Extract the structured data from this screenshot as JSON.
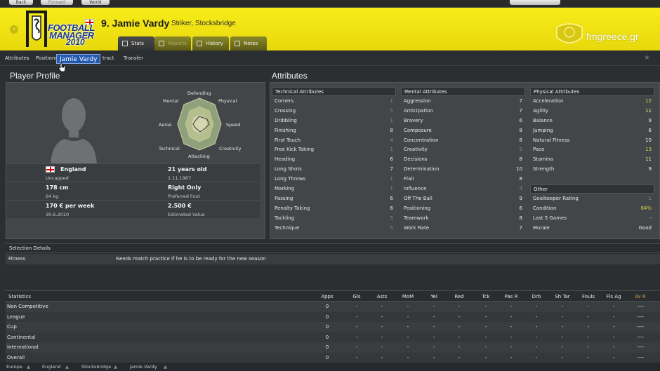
{
  "nav": {
    "back": "Back",
    "forward": "Forward",
    "world": "World"
  },
  "header": {
    "name": "9. Jamie Vardy",
    "subtitle": "Striker, Stocksbridge",
    "tabs": [
      {
        "label": "Stats"
      },
      {
        "label": "Reports"
      },
      {
        "label": "History"
      },
      {
        "label": "Notes"
      }
    ],
    "logo": {
      "line1": "FOOTBALL",
      "line2": "MANAGER",
      "line3": "2010"
    },
    "tooltip": "Jamie Vardy",
    "site": "fmgreece.gr",
    "accent": "#f3e515"
  },
  "subnav": [
    "Attributes",
    "Positions",
    "tract",
    "Transfer"
  ],
  "profile": {
    "title": "Player Profile",
    "radar_labels": [
      "Defending",
      "Physical",
      "Speed",
      "Creativity",
      "Attacking",
      "Technical",
      "Aerial",
      "Mental"
    ],
    "nationality": "England",
    "caps": "Uncapped",
    "age": "21 years old",
    "dob": "1.11.1987",
    "height": "178 cm",
    "weight": "64 kg",
    "foot": "Right Only",
    "foot_label": "Preferred Foot",
    "wage": "170 € per week",
    "contract": "30.6.2010",
    "value": "2.500 €",
    "value_label": "Estimated Value"
  },
  "attributes": {
    "title": "Attributes",
    "technical": {
      "head": "Technical Attributes",
      "rows": [
        [
          "Corners",
          "1"
        ],
        [
          "Crossing",
          "5"
        ],
        [
          "Dribbling",
          "1"
        ],
        [
          "Finishing",
          "8"
        ],
        [
          "First Touch",
          "4"
        ],
        [
          "Free Kick Taking",
          "1"
        ],
        [
          "Heading",
          "6"
        ],
        [
          "Long Shots",
          "7"
        ],
        [
          "Long Throws",
          "1"
        ],
        [
          "Marking",
          "1"
        ],
        [
          "Passing",
          "6"
        ],
        [
          "Penalty Taking",
          "6"
        ],
        [
          "Tackling",
          "5"
        ],
        [
          "Technique",
          "5"
        ]
      ]
    },
    "mental": {
      "head": "Mental Attributes",
      "rows": [
        [
          "Aggression",
          "7"
        ],
        [
          "Anticipation",
          "7"
        ],
        [
          "Bravery",
          "6"
        ],
        [
          "Composure",
          "8"
        ],
        [
          "Concentration",
          "8"
        ],
        [
          "Creativity",
          "5"
        ],
        [
          "Decisions",
          "8"
        ],
        [
          "Determination",
          "10"
        ],
        [
          "Flair",
          "8"
        ],
        [
          "Influence",
          "4"
        ],
        [
          "Off The Ball",
          "9"
        ],
        [
          "Positioning",
          "6"
        ],
        [
          "Teamwork",
          "8"
        ],
        [
          "Work Rate",
          "7"
        ]
      ]
    },
    "physical": {
      "head": "Physical Attributes",
      "rows": [
        [
          "Acceleration",
          "12"
        ],
        [
          "Agility",
          "11"
        ],
        [
          "Balance",
          "9"
        ],
        [
          "Jumping",
          "6"
        ],
        [
          "Natural Fitness",
          "10"
        ],
        [
          "Pace",
          "13"
        ],
        [
          "Stamina",
          "11"
        ],
        [
          "Strength",
          "9"
        ]
      ]
    },
    "other": {
      "head": "Other",
      "rows": [
        [
          "Goalkeeper Rating",
          "1"
        ],
        [
          "Condition",
          "84%"
        ],
        [
          "Last 5 Games",
          "-"
        ],
        [
          "Morale",
          "Good"
        ]
      ]
    }
  },
  "selection": {
    "head": "Selection Details",
    "label": "Fitness",
    "text": "Needs match practice if he is to be ready for the new season"
  },
  "stats": {
    "columns": [
      "Statistics",
      "Apps",
      "Gls",
      "Asts",
      "MoM",
      "Yel",
      "Red",
      "Tck",
      "Pas R",
      "Drb",
      "Sh Tar",
      "Fouls",
      "Fls Ag",
      "Av R"
    ],
    "rows": [
      [
        "Non Competitive",
        "0",
        "-",
        "-",
        "-",
        "-",
        "-",
        "-",
        "-",
        "-",
        "-",
        "-",
        "-",
        "----"
      ],
      [
        "League",
        "0",
        "-",
        "-",
        "-",
        "-",
        "-",
        "-",
        "-",
        "-",
        "-",
        "-",
        "-",
        "----"
      ],
      [
        "Cup",
        "0",
        "-",
        "-",
        "-",
        "-",
        "-",
        "-",
        "-",
        "-",
        "-",
        "-",
        "-",
        "----"
      ],
      [
        "Continental",
        "0",
        "-",
        "-",
        "-",
        "-",
        "-",
        "-",
        "-",
        "-",
        "-",
        "-",
        "-",
        "----"
      ],
      [
        "International",
        "0",
        "-",
        "-",
        "-",
        "-",
        "-",
        "-",
        "-",
        "-",
        "-",
        "-",
        "-",
        "----"
      ],
      [
        "Overall",
        "0",
        "-",
        "-",
        "-",
        "-",
        "-",
        "-",
        "-",
        "-",
        "-",
        "-",
        "-",
        "----"
      ]
    ]
  },
  "footer": [
    "Europe",
    "England",
    "Stocksbridge",
    "Jamie Vardy"
  ]
}
